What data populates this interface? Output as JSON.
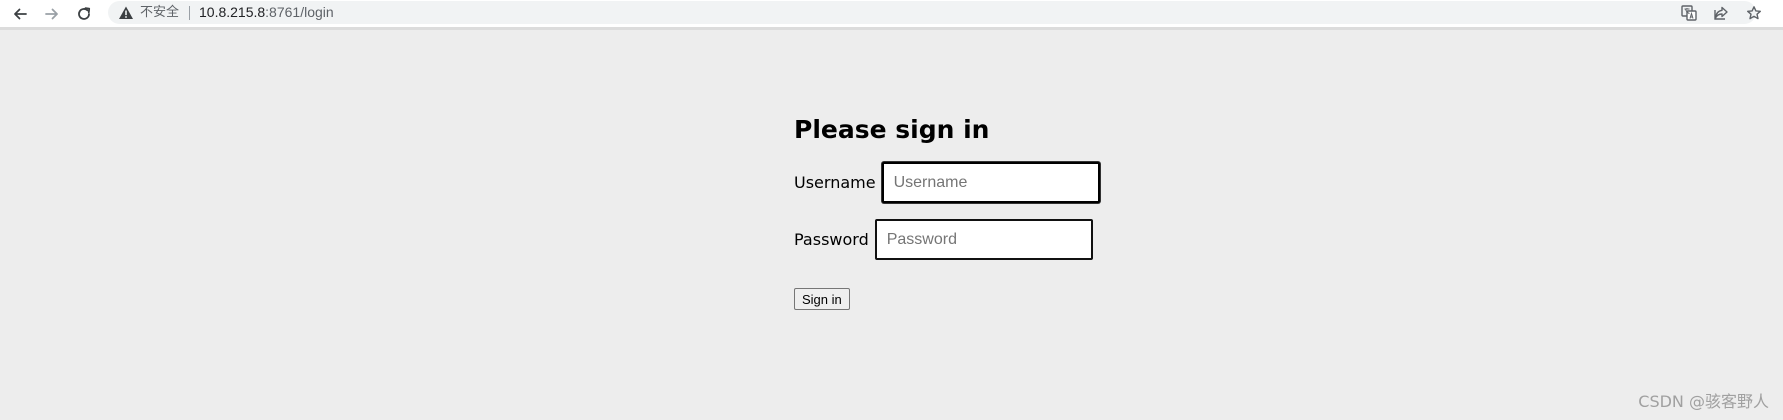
{
  "browser": {
    "insecure_label": "不安全",
    "url_host": "10.8.215.8",
    "url_rest": ":8761/login",
    "icons": {
      "back": "arrow-left-icon",
      "forward": "arrow-right-icon",
      "reload": "reload-icon",
      "warning": "warning-triangle-icon",
      "translate": "translate-icon",
      "share": "share-icon",
      "bookmark": "star-icon"
    }
  },
  "login": {
    "title": "Please sign in",
    "username_label": "Username",
    "username_placeholder": "Username",
    "username_value": "",
    "password_label": "Password",
    "password_placeholder": "Password",
    "password_value": "",
    "submit_label": "Sign in"
  },
  "watermark": "CSDN @骇客野人",
  "colors": {
    "page_background": "#ededed",
    "toolbar_background": "#ffffff",
    "omnibox_background": "#f1f3f4"
  }
}
